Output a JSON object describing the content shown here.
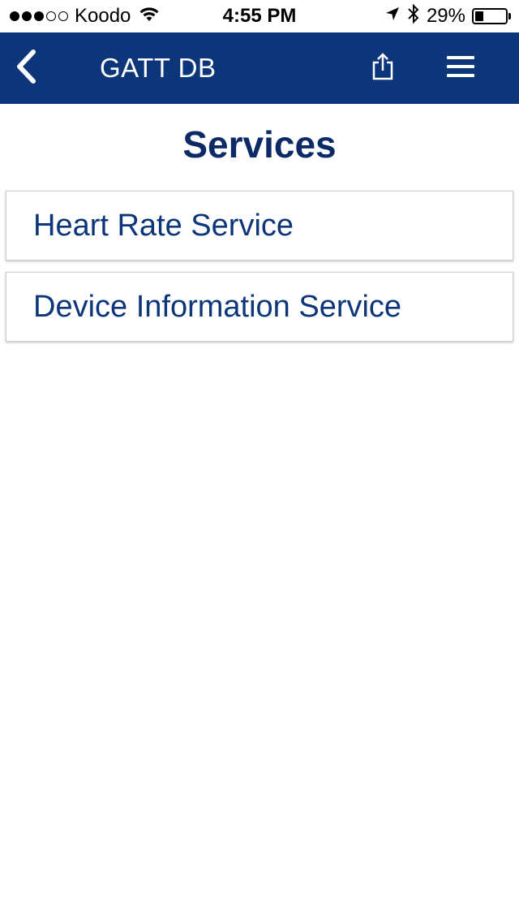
{
  "status_bar": {
    "signal_filled": 3,
    "signal_empty": 2,
    "carrier": "Koodo",
    "time": "4:55 PM",
    "battery_percent": "29%",
    "battery_level": 0.29
  },
  "nav": {
    "title": "GATT DB",
    "back_icon": "chevron-left-icon",
    "share_icon": "share-icon",
    "menu_icon": "hamburger-menu-icon",
    "background_color": "#0c3679"
  },
  "page": {
    "title": "Services"
  },
  "services": [
    {
      "label": "Heart Rate Service"
    },
    {
      "label": "Device Information Service"
    }
  ],
  "colors": {
    "accent": "#0c3679",
    "title": "#0c2a66"
  }
}
